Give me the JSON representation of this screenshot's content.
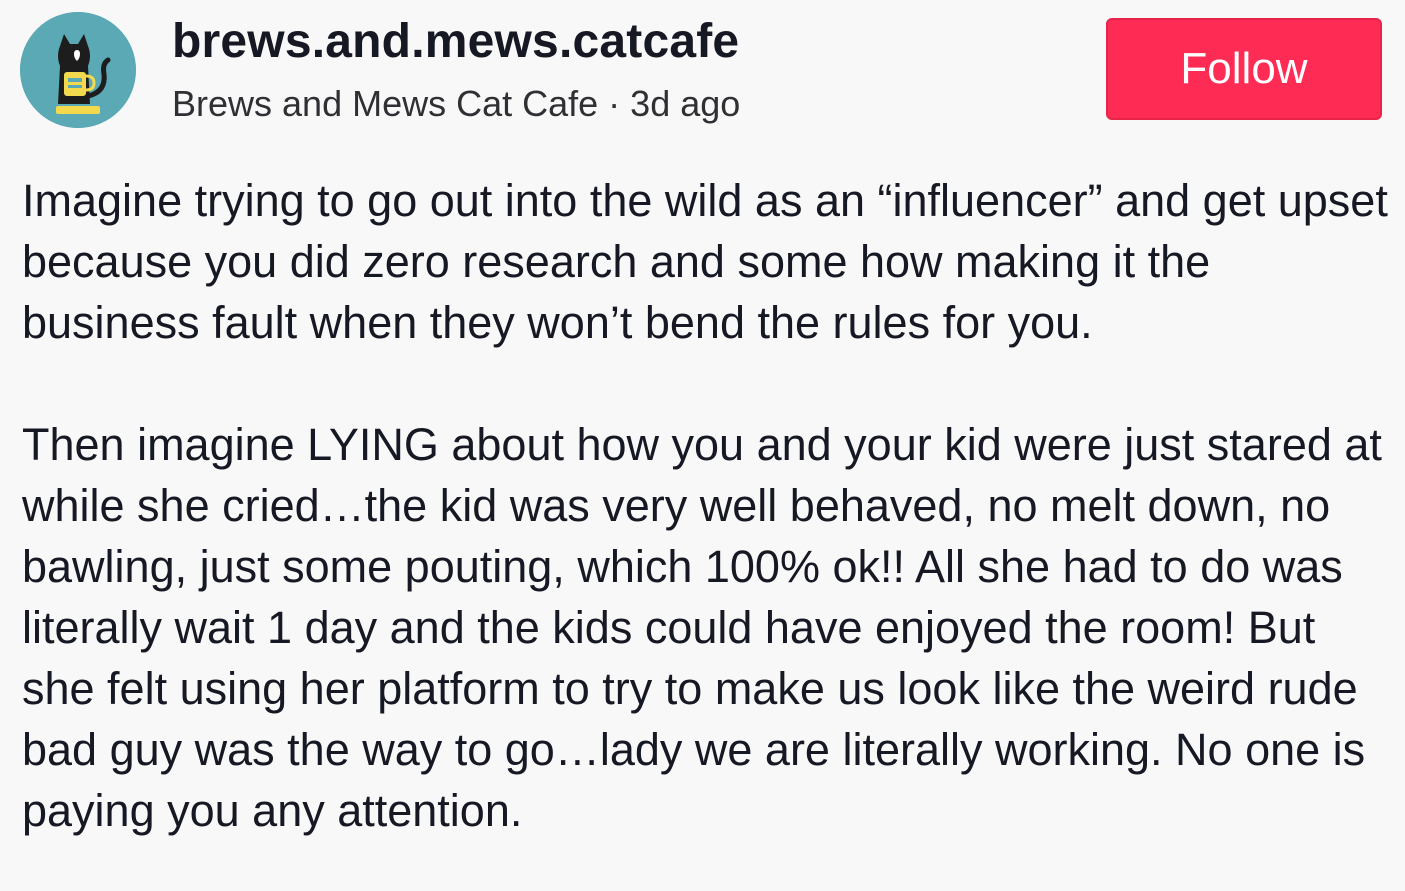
{
  "post": {
    "username": "brews.and.mews.catcafe",
    "display_name": "Brews and Mews Cat Cafe",
    "separator": " · ",
    "timestamp": "3d ago",
    "follow_label": "Follow",
    "avatar_icon": "cat-cafe-logo-icon",
    "paragraphs": [
      "Imagine trying to go out into the wild as an “influencer” and get upset because you did zero research and some how making it the business fault when they won’t bend the rules for you.",
      "Then imagine LYING about how you and your kid were just stared at while she cried…the kid was very well behaved, no melt down, no bawling, just some pouting, which 100% ok!! All she had to do was literally wait 1 day and the kids could have enjoyed the room! But she felt using her platform to try to make us look like the weird rude bad guy was the way to go…lady we are literally working. No one is paying you any attention."
    ]
  },
  "colors": {
    "background": "#f8f8f8",
    "follow_button": "#fe2c55",
    "avatar_bg": "#5aa9b5",
    "text": "#161823"
  }
}
